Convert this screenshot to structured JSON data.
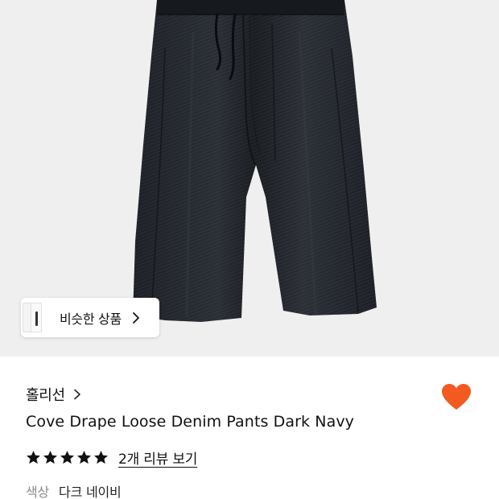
{
  "product_image": {
    "alt": ""
  },
  "similar_items": {
    "label": "비슷한 상품"
  },
  "brand": {
    "name": "홀리선"
  },
  "product": {
    "name": "Cove Drape Loose Denim Pants Dark Navy",
    "rating": 5,
    "review_link": "2개 리뷰 보기",
    "liked": true
  },
  "color": {
    "label": "색상",
    "value": "다크 네이비"
  },
  "colors": {
    "heart": "#f25a1f",
    "star": "#111111",
    "image_bg": "#efefef",
    "pants": "#23272e"
  },
  "icons": {
    "chip_chevron": "chevron-right-icon",
    "brand_chevron": "chevron-right-icon",
    "like": "heart-icon",
    "star": "star-icon"
  }
}
